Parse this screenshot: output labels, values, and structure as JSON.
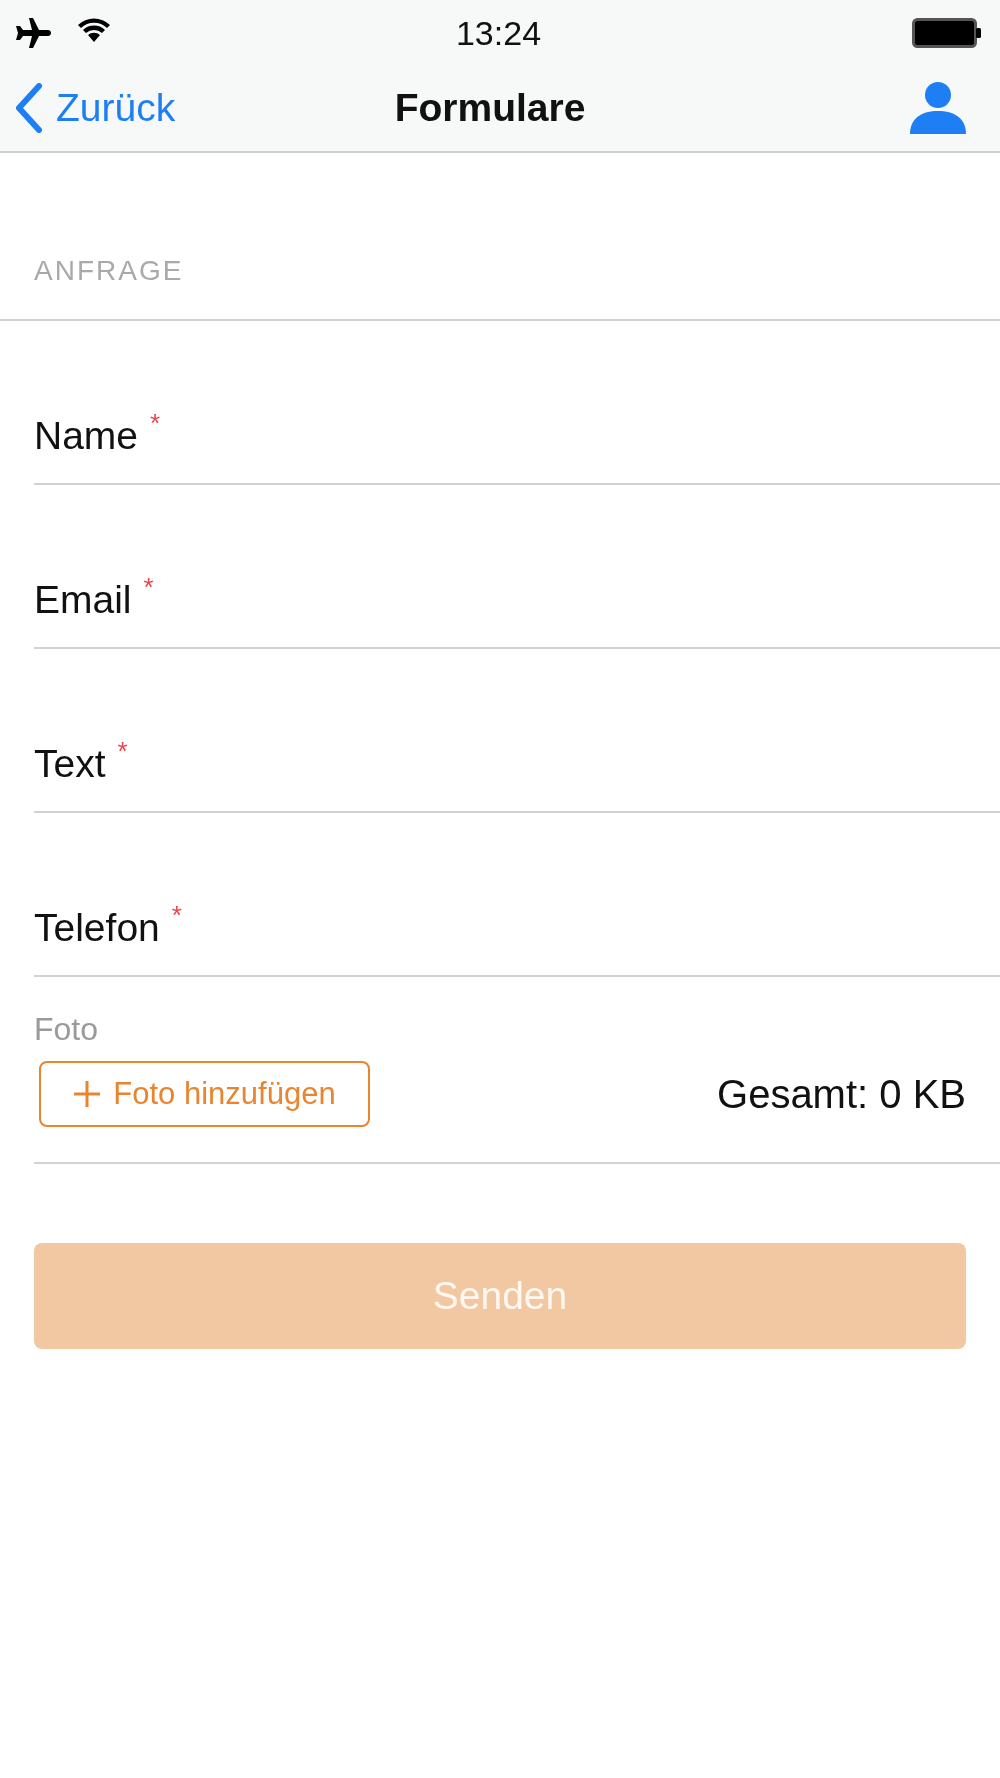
{
  "status_bar": {
    "time": "13:24"
  },
  "nav_bar": {
    "back_label": "Zurück",
    "title": "Formulare"
  },
  "form": {
    "section_header": "ANFRAGE",
    "required_mark": "*",
    "fields": [
      {
        "label": "Name",
        "required": true
      },
      {
        "label": "Email",
        "required": true
      },
      {
        "label": "Text",
        "required": true
      },
      {
        "label": "Telefon",
        "required": true
      }
    ],
    "photo": {
      "label": "Foto",
      "add_button": "Foto hinzufügen",
      "total": "Gesamt: 0 KB"
    },
    "submit_button": {
      "label": "Senden",
      "disabled": true
    }
  }
}
